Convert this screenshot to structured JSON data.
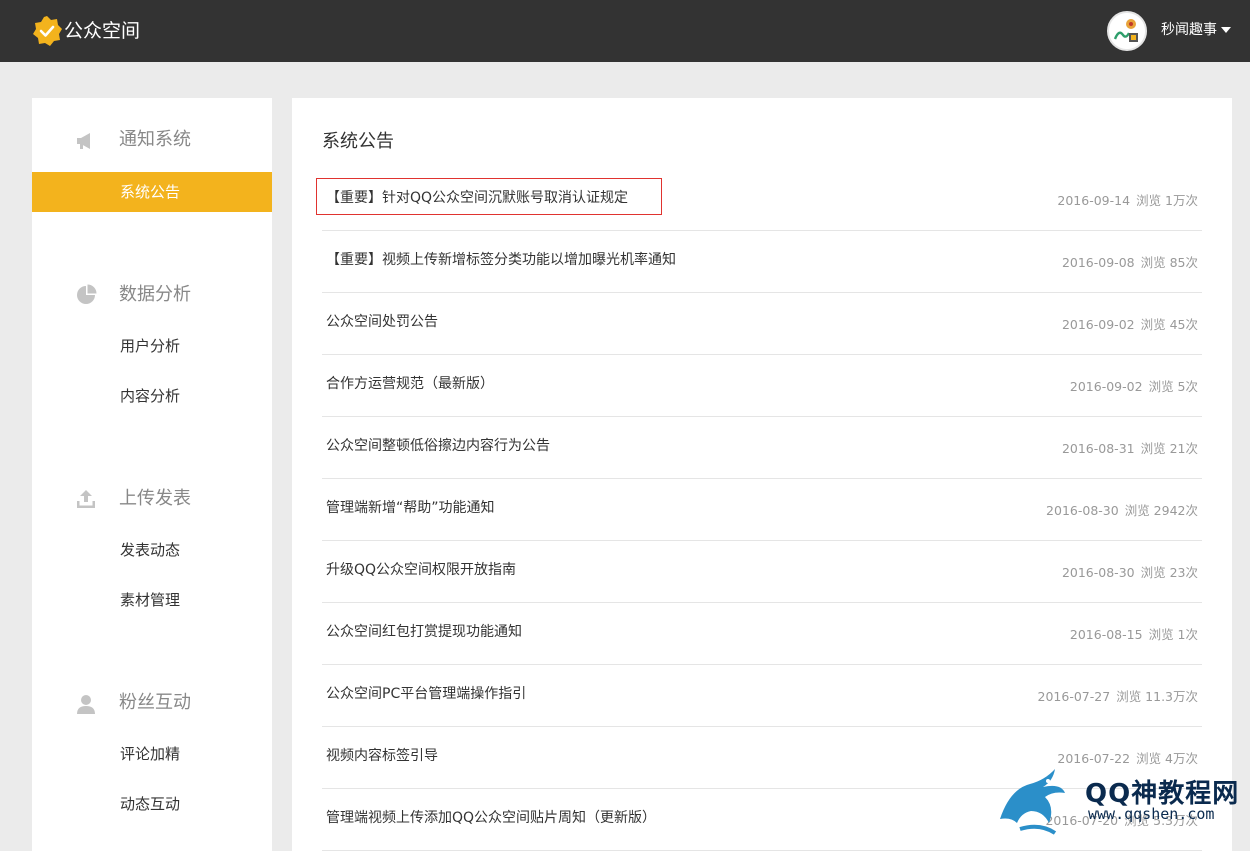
{
  "header": {
    "app_name": "公众空间",
    "username": "秒闻趣事"
  },
  "sidebar": {
    "sections": [
      {
        "title": "通知系统",
        "icon": "megaphone-icon",
        "items": [
          "系统公告"
        ]
      },
      {
        "title": "数据分析",
        "icon": "pie-chart-icon",
        "items": [
          "用户分析",
          "内容分析"
        ]
      },
      {
        "title": "上传发表",
        "icon": "upload-icon",
        "items": [
          "发表动态",
          "素材管理"
        ]
      },
      {
        "title": "粉丝互动",
        "icon": "user-icon",
        "items": [
          "评论加精",
          "动态互动"
        ]
      }
    ],
    "active_item": "系统公告"
  },
  "main": {
    "title": "系统公告",
    "notices": [
      {
        "title": "【重要】针对QQ公众空间沉默账号取消认证规定",
        "date": "2016-09-14",
        "views": "浏览 1万次"
      },
      {
        "title": "【重要】视频上传新增标签分类功能以增加曝光机率通知",
        "date": "2016-09-08",
        "views": "浏览 85次"
      },
      {
        "title": "公众空间处罚公告",
        "date": "2016-09-02",
        "views": "浏览 45次"
      },
      {
        "title": "合作方运营规范（最新版）",
        "date": "2016-09-02",
        "views": "浏览 5次"
      },
      {
        "title": "公众空间整顿低俗擦边内容行为公告",
        "date": "2016-08-31",
        "views": "浏览 21次"
      },
      {
        "title": "管理端新增“帮助”功能通知",
        "date": "2016-08-30",
        "views": "浏览 2942次"
      },
      {
        "title": "升级QQ公众空间权限开放指南",
        "date": "2016-08-30",
        "views": "浏览 23次"
      },
      {
        "title": "公众空间红包打赏提现功能通知",
        "date": "2016-08-15",
        "views": "浏览 1次"
      },
      {
        "title": "公众空间PC平台管理端操作指引",
        "date": "2016-07-27",
        "views": "浏览 11.3万次"
      },
      {
        "title": "视频内容标签引导",
        "date": "2016-07-22",
        "views": "浏览 4万次"
      },
      {
        "title": "管理端视频上传添加QQ公众空间贴片周知（更新版）",
        "date": "2016-07-20",
        "views": "浏览 5.3万次"
      }
    ]
  },
  "watermark": {
    "name": "QQ神教程网",
    "url": "www.qqshen.com"
  },
  "colors": {
    "header_bg": "#333333",
    "accent": "#f3b31d",
    "highlight_border": "#e0332f",
    "page_bg": "#ebebeb"
  }
}
